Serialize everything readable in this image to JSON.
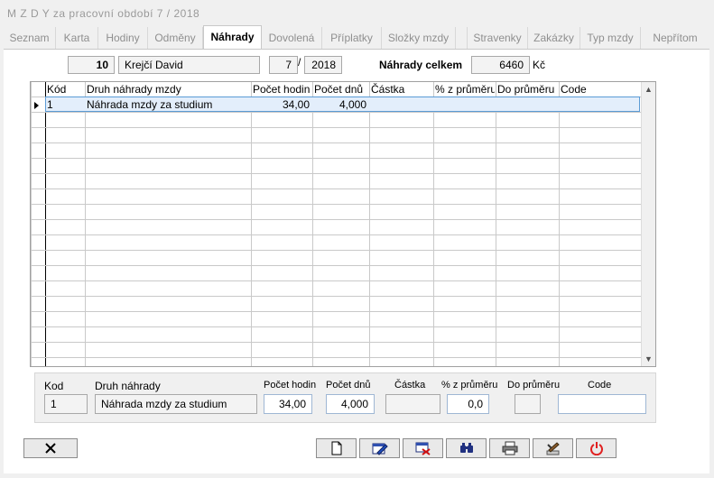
{
  "window": {
    "title": "M Z D Y  za pracovní období  7 / 2018"
  },
  "tabs": [
    "Seznam",
    "Karta",
    "Hodiny",
    "Odměny",
    "Náhrady",
    "Dovolená",
    "Příplatky",
    "Složky mzdy",
    "",
    "Stravenky",
    "Zakázky",
    "Typ mzdy",
    "Nepřítom"
  ],
  "active_tab": "Náhrady",
  "header": {
    "employee_number": "10",
    "employee_name": "Krejčí David",
    "period_month": "7",
    "period_separator": "/",
    "period_year": "2018",
    "total_label": "Náhrady celkem",
    "total_value": "6460",
    "currency": "Kč"
  },
  "grid": {
    "columns": [
      "Kód",
      "Druh náhrady mzdy",
      "Počet hodin",
      "Počet dnů",
      "Částka",
      "% z průměru",
      "Do průměru",
      "Code"
    ],
    "rows": [
      [
        "1",
        "Náhrada mzdy za studium",
        "34,00",
        "4,000",
        "",
        "",
        "",
        ""
      ]
    ],
    "empty_rows": 17
  },
  "detail": {
    "labels": {
      "kod": "Kod",
      "druh": "Druh náhrady",
      "pocet_hodin": "Počet hodin",
      "pocet_dnu": "Počet dnů",
      "castka": "Částka",
      "pct": "% z průměru",
      "do_prumeru": "Do průměru",
      "code": "Code"
    },
    "values": {
      "kod": "1",
      "druh": "Náhrada mzdy za studium",
      "pocet_hodin": "34,00",
      "pocet_dnu": "4,000",
      "castka": "",
      "pct": "0,0",
      "do_prumeru": "",
      "code": ""
    }
  },
  "toolbar_icons": [
    "close-icon",
    "new-document-icon",
    "edit-icon",
    "delete-icon",
    "find-icon",
    "print-icon",
    "tools-icon",
    "power-icon"
  ],
  "colors": {
    "selection_row": "#e3eefb",
    "selection_border": "#5b9bd5",
    "power_red": "#e02020"
  }
}
